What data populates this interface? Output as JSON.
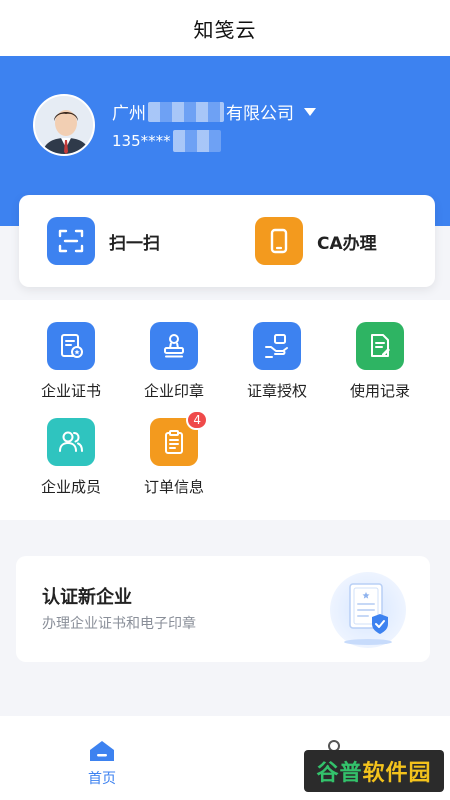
{
  "app": {
    "title": "知笺云"
  },
  "account": {
    "company_prefix": "广州",
    "company_suffix": "有限公司",
    "phone": "135****"
  },
  "quick_actions": [
    {
      "label": "扫一扫",
      "icon": "scan-icon",
      "color": "#3d82f0"
    },
    {
      "label": "CA办理",
      "icon": "phone-device-icon",
      "color": "#f39a1e"
    }
  ],
  "menu": [
    {
      "label": "企业证书",
      "icon": "certificate-icon",
      "color": "#3d82f0"
    },
    {
      "label": "企业印章",
      "icon": "stamp-icon",
      "color": "#3d82f0"
    },
    {
      "label": "证章授权",
      "icon": "authorize-hand-icon",
      "color": "#3d82f0"
    },
    {
      "label": "使用记录",
      "icon": "record-icon",
      "color": "#2eb463"
    },
    {
      "label": "企业成员",
      "icon": "members-icon",
      "color": "#2fc4bf"
    },
    {
      "label": "订单信息",
      "icon": "order-icon",
      "color": "#f39a1e",
      "badge": "4"
    }
  ],
  "promo": {
    "title": "认证新企业",
    "subtitle": "办理企业证书和电子印章",
    "icon": "certificate-shield-illustration"
  },
  "tabbar": {
    "home_label": "首页",
    "active_color": "#3d82f0"
  },
  "watermark": {
    "part1": "谷普",
    "part2": "软件园"
  }
}
